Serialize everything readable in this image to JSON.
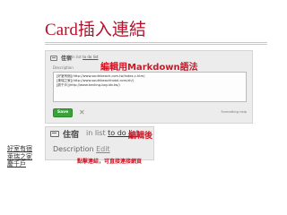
{
  "slide": {
    "title": "Card插入連結"
  },
  "edit_panel": {
    "card_title": "佳宿",
    "in_list_prefix": "in list",
    "list_name": "to do list",
    "description_label": "Description",
    "markdown_lines": [
      "[好室有宿](http://www.southbeach.com.tw/index-c.htm)",
      "[萊瑞之家](http://www.southbeachhotel.com/zh/)",
      "[慶千戶](http://www.kenting-bay.idv.tw/)"
    ],
    "save_label": "Save",
    "close_symbol": "✕",
    "formatting_help": "Formatting help",
    "annotation": "編輯用Markdown語法"
  },
  "view_panel": {
    "card_title": "住宿",
    "in_list_prefix": "in list",
    "list_name": "to do list",
    "description_label": "Description",
    "edit_link": "Edit",
    "links": [
      "好室有宿",
      "萊瑞之家",
      "慶千戶"
    ],
    "annotation_after": "編輯後",
    "annotation_click": "點擊連結，可直接連接網頁"
  },
  "colors": {
    "title_red": "#b3132c",
    "annotation_red": "#d21525",
    "save_green": "#3aa23a",
    "panel_bg": "#ececec"
  }
}
